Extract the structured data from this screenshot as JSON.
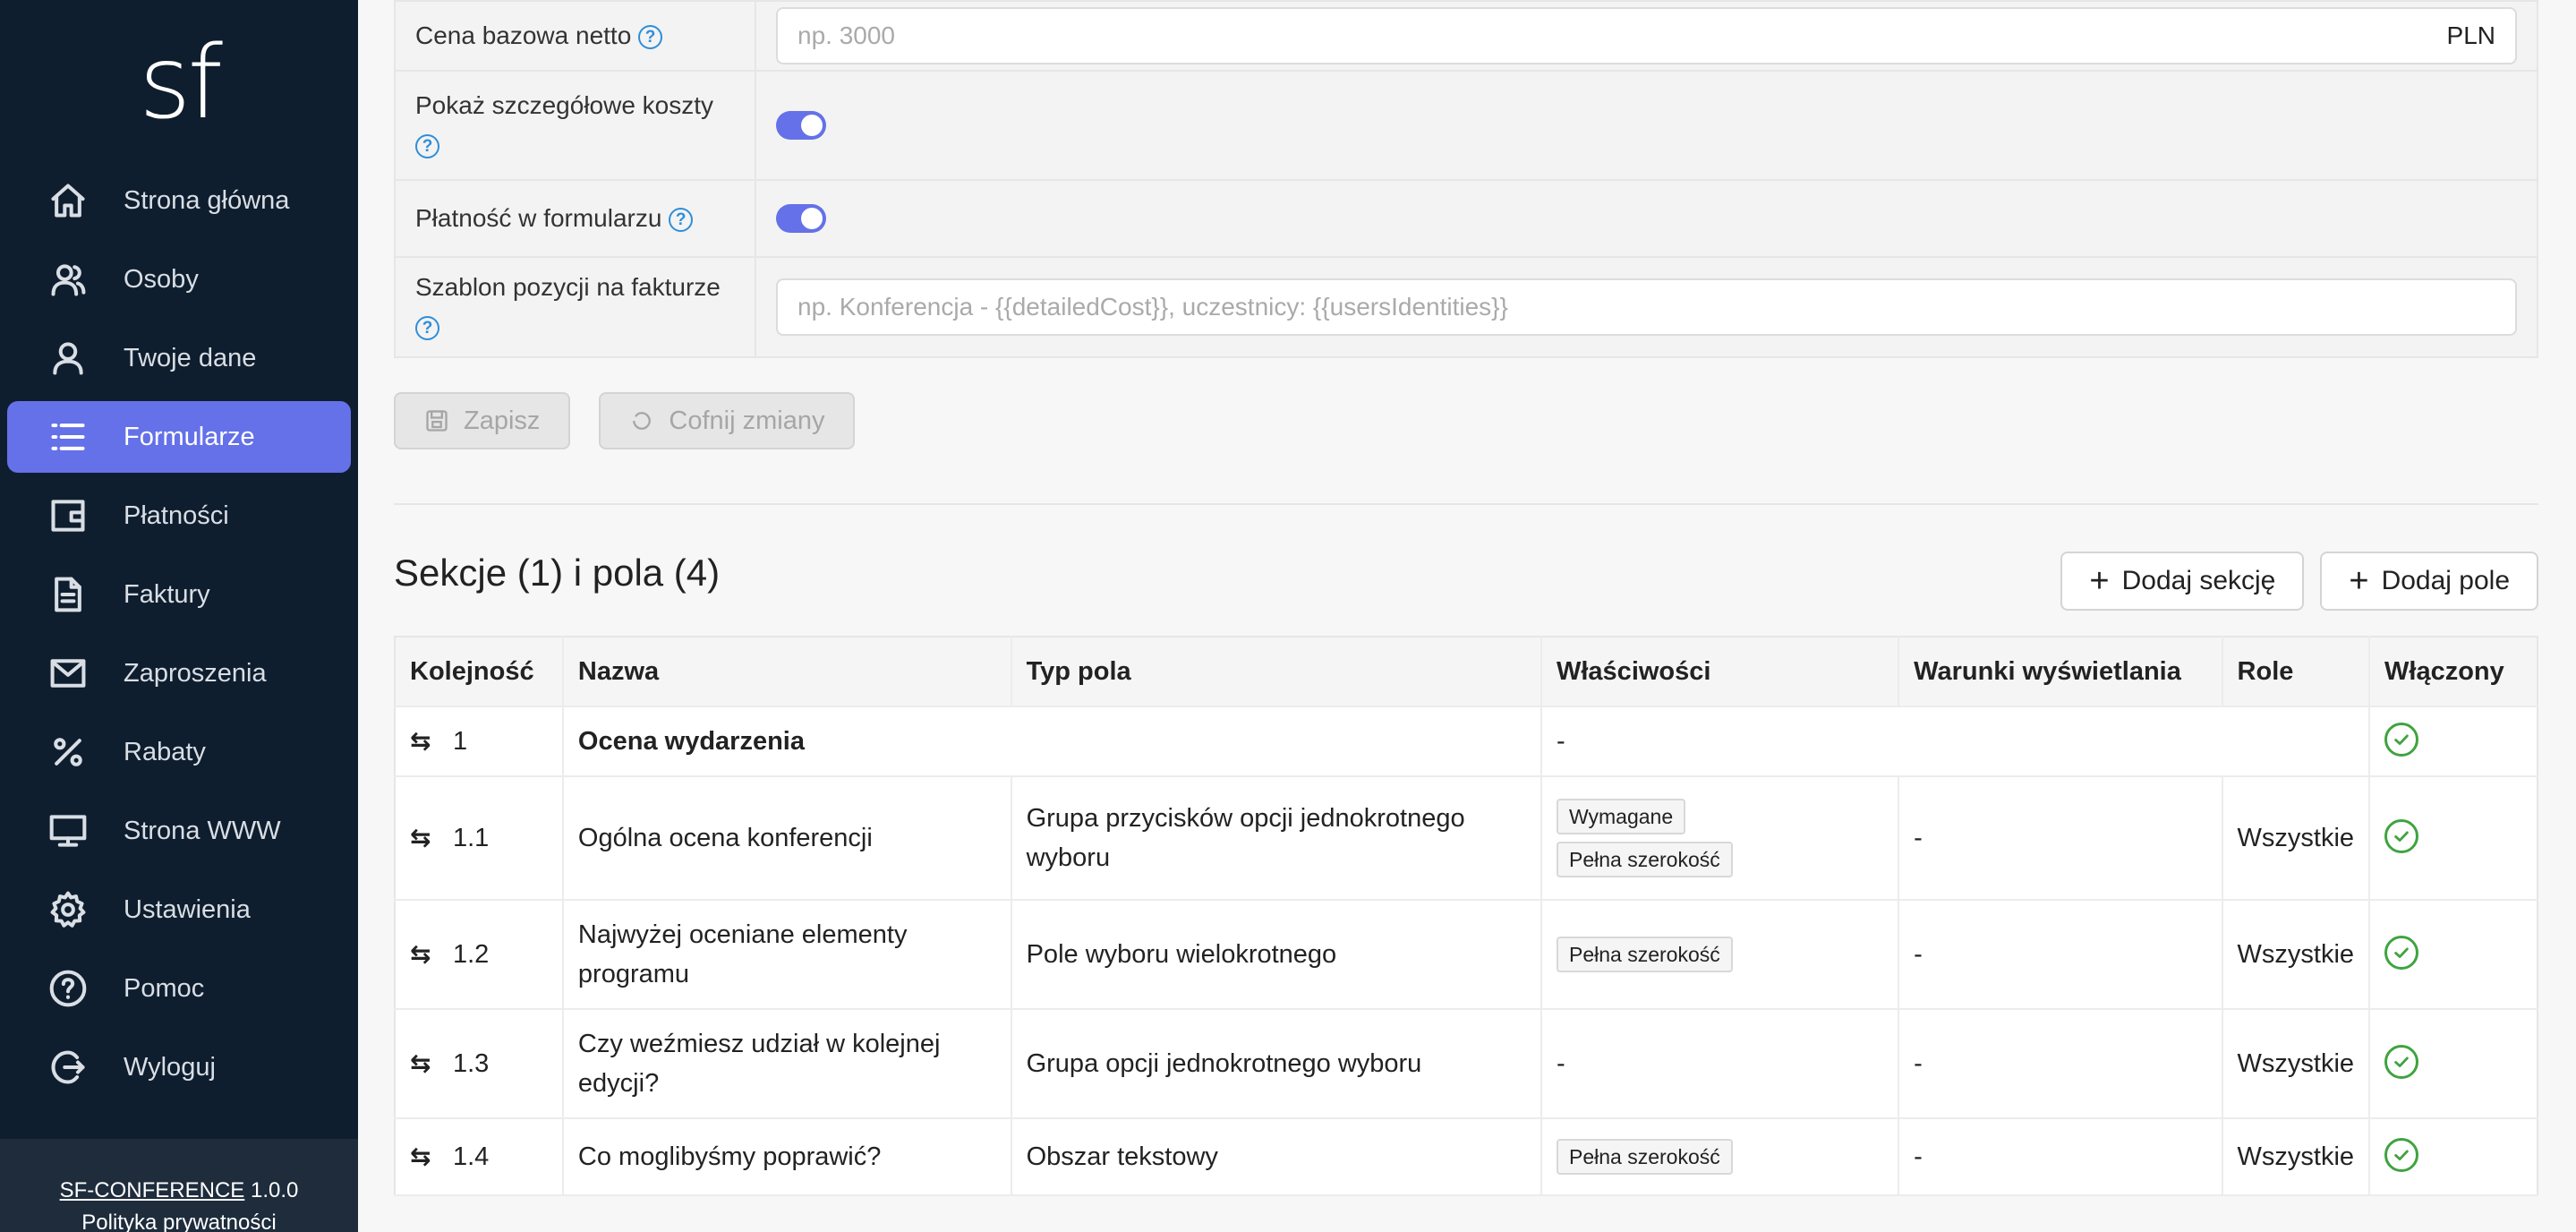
{
  "sidebar": {
    "logo": "sf",
    "items": [
      {
        "label": "Strona główna",
        "icon": "home-icon"
      },
      {
        "label": "Osoby",
        "icon": "people-icon"
      },
      {
        "label": "Twoje dane",
        "icon": "user-icon"
      },
      {
        "label": "Formularze",
        "icon": "list-icon",
        "active": true
      },
      {
        "label": "Płatności",
        "icon": "wallet-icon"
      },
      {
        "label": "Faktury",
        "icon": "document-icon"
      },
      {
        "label": "Zaproszenia",
        "icon": "envelope-icon"
      },
      {
        "label": "Rabaty",
        "icon": "percent-icon"
      },
      {
        "label": "Strona WWW",
        "icon": "monitor-icon"
      },
      {
        "label": "Ustawienia",
        "icon": "gear-icon"
      },
      {
        "label": "Pomoc",
        "icon": "help-icon"
      },
      {
        "label": "Wyloguj",
        "icon": "logout-icon"
      }
    ],
    "footer": {
      "app_name": "SF-CONFERENCE",
      "version": "1.0.0",
      "privacy": "Polityka prywatności"
    }
  },
  "form": {
    "base_price_label": "Cena bazowa netto",
    "base_price_placeholder": "np. 3000",
    "base_price_suffix": "PLN",
    "detailed_costs_label": "Pokaż szczegółowe koszty",
    "detailed_costs_on": true,
    "payment_label": "Płatność w formularzu",
    "payment_on": true,
    "invoice_template_label": "Szablon pozycji na fakturze",
    "invoice_template_placeholder": "np. Konferencja - {{detailedCost}}, uczestnicy: {{usersIdentities}}"
  },
  "actions": {
    "save": "Zapisz",
    "revert": "Cofnij zmiany"
  },
  "sections": {
    "title": "Sekcje (1) i pola (4)",
    "add_section": "Dodaj sekcję",
    "add_field": "Dodaj pole",
    "columns": [
      "Kolejność",
      "Nazwa",
      "Typ pola",
      "Właściwości",
      "Warunki wyświetlania",
      "Role",
      "Włączony"
    ],
    "section_row": {
      "order": "1",
      "name": "Ocena wydarzenia",
      "properties": "-",
      "enabled": true
    },
    "rows": [
      {
        "order": "1.1",
        "name": "Ogólna ocena konferencji",
        "type": "Grupa przycisków opcji jednokrotnego wyboru",
        "tags": [
          "Wymagane",
          "Pełna szerokość"
        ],
        "conditions": "-",
        "roles": "Wszystkie",
        "enabled": true
      },
      {
        "order": "1.2",
        "name": "Najwyżej oceniane elementy programu",
        "type": "Pole wyboru wielokrotnego",
        "tags": [
          "Pełna szerokość"
        ],
        "conditions": "-",
        "roles": "Wszystkie",
        "enabled": true
      },
      {
        "order": "1.3",
        "name": "Czy weźmiesz udział w kolejnej edycji?",
        "type": "Grupa opcji jednokrotnego wyboru",
        "properties": "-",
        "tags": [],
        "conditions": "-",
        "roles": "Wszystkie",
        "enabled": true
      },
      {
        "order": "1.4",
        "name": "Co moglibyśmy poprawić?",
        "type": "Obszar tekstowy",
        "tags": [
          "Pełna szerokość"
        ],
        "conditions": "-",
        "roles": "Wszystkie",
        "enabled": true
      }
    ]
  },
  "colors": {
    "sidebar_bg": "#0f1e2e",
    "accent": "#6471e8",
    "success": "#3fa33f",
    "help": "#2e8ed8"
  }
}
